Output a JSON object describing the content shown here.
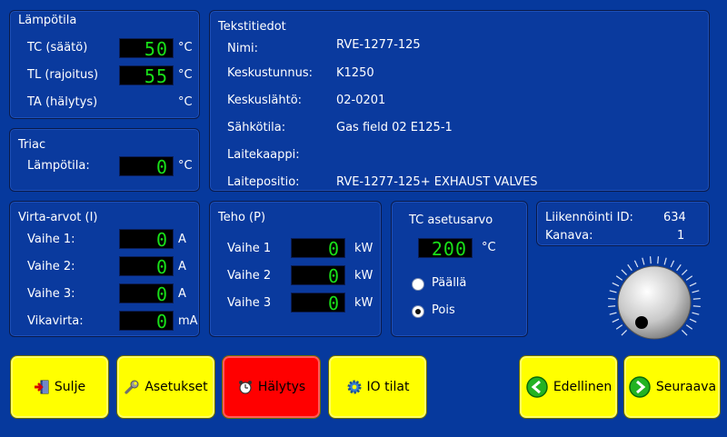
{
  "temperature": {
    "title": "Lämpötila",
    "rows": [
      {
        "label": "TC (säätö)",
        "value": "50",
        "unit": "°C"
      },
      {
        "label": "TL (rajoitus)",
        "value": "55",
        "unit": "°C"
      },
      {
        "label": "TA (hälytys)",
        "value": "",
        "unit": "°C"
      }
    ]
  },
  "triac": {
    "title": "Triac",
    "label": "Lämpötila:",
    "value": "0",
    "unit": "°C"
  },
  "text_info": {
    "title": "Tekstitiedot",
    "rows": [
      {
        "label": "Nimi:",
        "value": "RVE-1277-125"
      },
      {
        "label": "Keskustunnus:",
        "value": "K1250"
      },
      {
        "label": "Keskuslähtö:",
        "value": "02-0201"
      },
      {
        "label": "Sähkötila:",
        "value": "Gas field 02 E125-1"
      },
      {
        "label": "Laitekaappi:",
        "value": ""
      },
      {
        "label": "Laitepositio:",
        "value": "RVE-1277-125+ EXHAUST VALVES"
      }
    ]
  },
  "current": {
    "title": "Virta-arvot (I)",
    "rows": [
      {
        "label": "Vaihe 1:",
        "value": "0",
        "unit": "A"
      },
      {
        "label": "Vaihe 2:",
        "value": "0",
        "unit": "A"
      },
      {
        "label": "Vaihe 3:",
        "value": "0",
        "unit": "A"
      },
      {
        "label": "Vikavirta:",
        "value": "0",
        "unit": "mA"
      }
    ]
  },
  "power": {
    "title": "Teho (P)",
    "rows": [
      {
        "label": "Vaihe 1",
        "value": "0",
        "unit": "kW"
      },
      {
        "label": "Vaihe 2",
        "value": "0",
        "unit": "kW"
      },
      {
        "label": "Vaihe 3",
        "value": "0",
        "unit": "kW"
      }
    ]
  },
  "setpoint": {
    "title": "TC asetusarvo",
    "value": "200",
    "unit": "°C",
    "on_label": "Päällä",
    "off_label": "Pois",
    "selected": "off"
  },
  "comm": {
    "id_label": "Liikennöinti ID:",
    "id_value": "634",
    "channel_label": "Kanava:",
    "channel_value": "1"
  },
  "buttons": {
    "close": "Sulje",
    "settings": "Asetukset",
    "alarm": "Hälytys",
    "io": "IO tilat",
    "prev": "Edellinen",
    "next": "Seuraava"
  },
  "colors": {
    "background": "#06399d",
    "display_text": "#19e019",
    "button": "#ffff00",
    "alarm_button": "#ff0000",
    "nav_arrow": "#22b322"
  },
  "icons": {
    "close": "exit-door-icon",
    "settings": "wrench-icon",
    "alarm": "alarm-clock-icon",
    "io": "gear-icon",
    "prev": "arrow-left-circle-icon",
    "next": "arrow-right-circle-icon",
    "knob": "rotary-knob-icon"
  }
}
